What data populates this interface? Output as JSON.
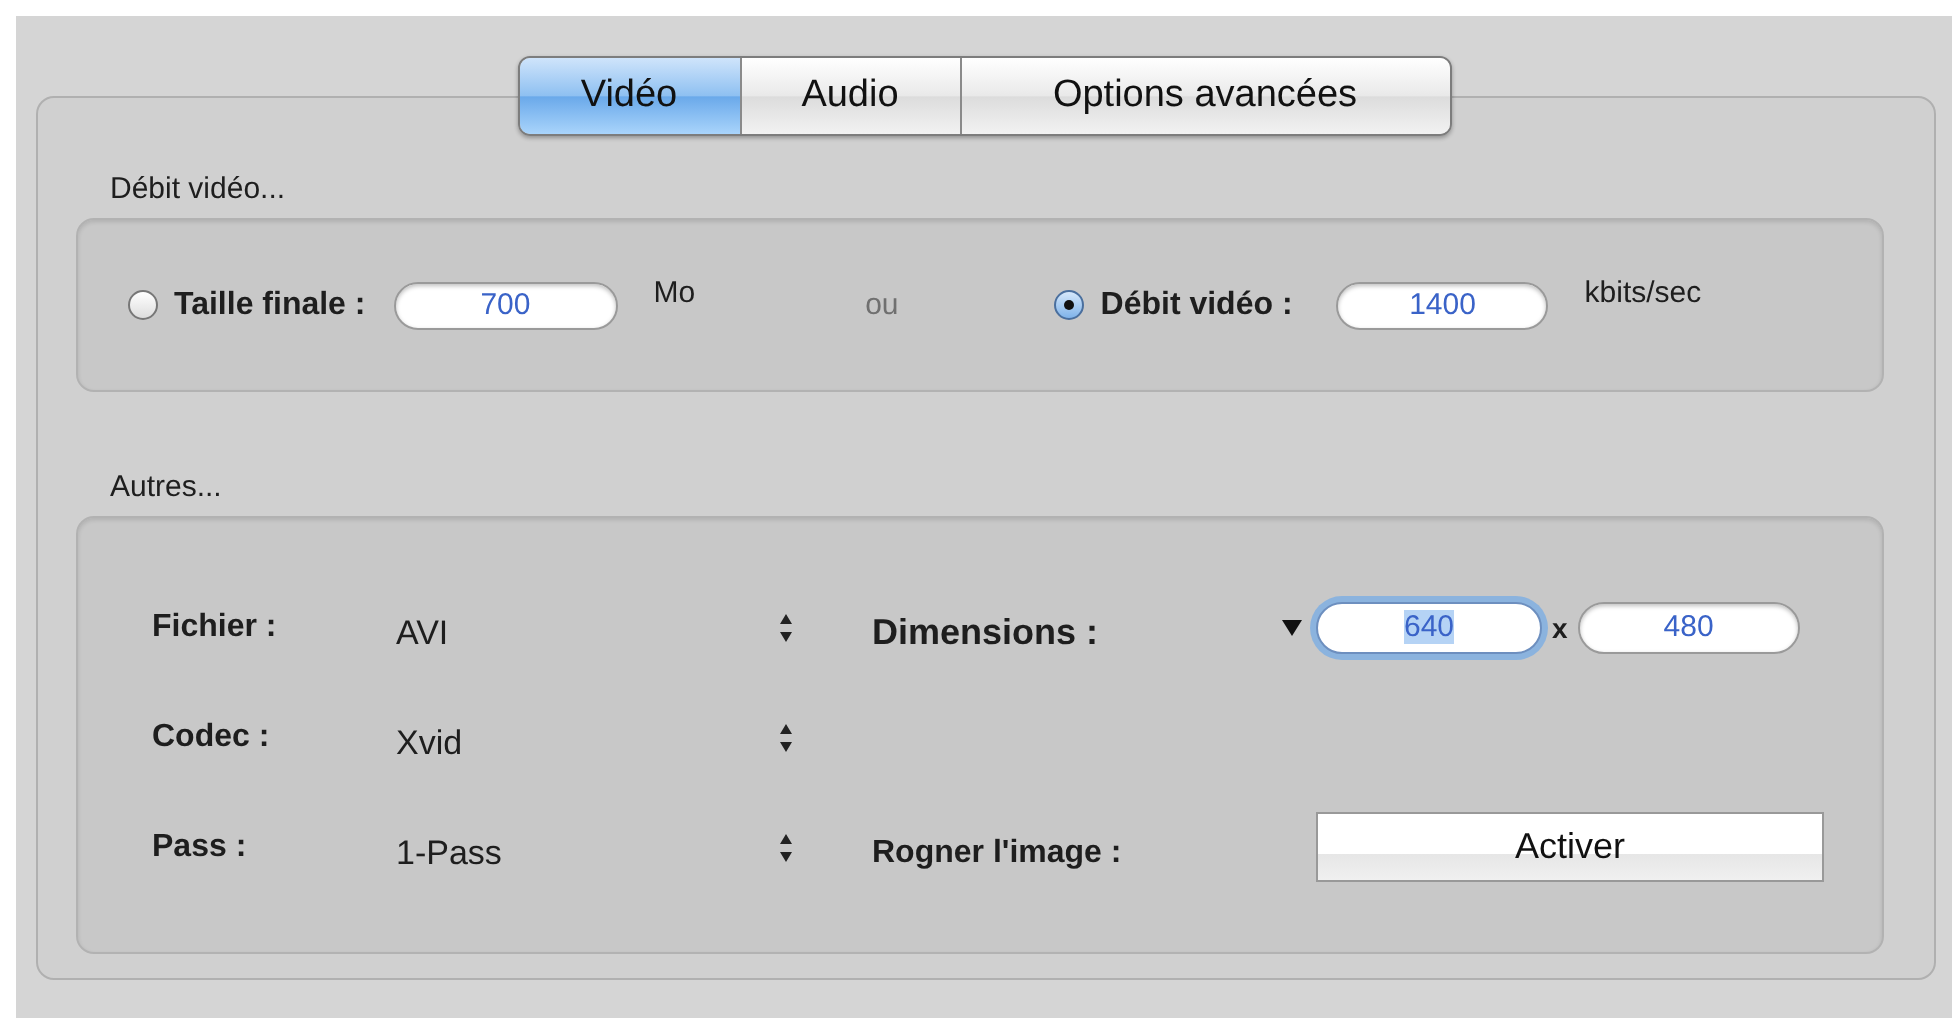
{
  "tabs": [
    {
      "label": "Vidéo",
      "selected": true
    },
    {
      "label": "Audio",
      "selected": false
    },
    {
      "label": "Options avancées",
      "selected": false
    }
  ],
  "bitrate_section": {
    "title": "Débit vidéo...",
    "separator": "ou",
    "options": [
      {
        "label": "Taille finale :",
        "selected": false,
        "value": "700",
        "unit": "Mo"
      },
      {
        "label": "Débit vidéo :",
        "selected": true,
        "value": "1400",
        "unit": "kbits/sec"
      }
    ]
  },
  "other_section": {
    "title": "Autres...",
    "popups": [
      {
        "label": "Fichier :",
        "value": "AVI"
      },
      {
        "label": "Codec :",
        "value": "Xvid"
      },
      {
        "label": "Pass :",
        "value": "1-Pass"
      }
    ],
    "dimensions": {
      "label": "Dimensions :",
      "separator": "x",
      "fields": [
        {
          "value": "640",
          "focused": true
        },
        {
          "value": "480",
          "focused": false
        }
      ]
    },
    "crop": {
      "label": "Rogner l'image :",
      "button": "Activer"
    }
  }
}
